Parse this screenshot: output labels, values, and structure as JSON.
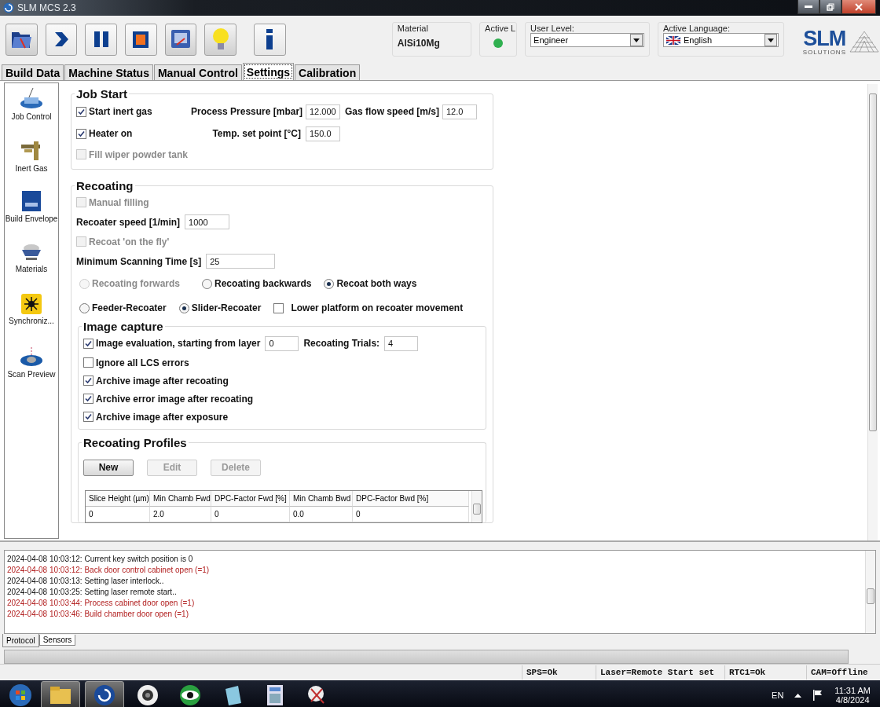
{
  "window": {
    "title": "SLM MCS 2.3"
  },
  "header": {
    "material": {
      "label": "Material",
      "value": "AlSi10Mg"
    },
    "active_laser": {
      "label": "Active L",
      "on": true
    },
    "user_level": {
      "label": "User Level:",
      "value": "Engineer"
    },
    "language": {
      "label": "Active Language:",
      "value": "English"
    },
    "logo": {
      "name": "SLM",
      "tagline": "SOLUTIONS"
    }
  },
  "tabs": [
    {
      "label": "Build Data",
      "selected": false
    },
    {
      "label": "Machine Status",
      "selected": false
    },
    {
      "label": "Manual Control",
      "selected": false
    },
    {
      "label": "Settings",
      "selected": true
    },
    {
      "label": "Calibration",
      "selected": false
    }
  ],
  "sidebar": {
    "items": [
      {
        "label": "Job Control",
        "kind": "job"
      },
      {
        "label": "Inert Gas",
        "kind": "gas"
      },
      {
        "label": "Build Envelope",
        "kind": "envelope"
      },
      {
        "label": "Materials",
        "kind": "materials"
      },
      {
        "label": "Synchroniz...",
        "kind": "sync"
      },
      {
        "label": "Scan Preview",
        "kind": "scan"
      }
    ]
  },
  "job_start": {
    "title": "Job Start",
    "start_inert_gas": {
      "label": "Start inert gas",
      "checked": true,
      "disabled": false
    },
    "process_pressure": {
      "label": "Process Pressure [mbar]",
      "value": "12.000"
    },
    "gas_flow_speed": {
      "label": "Gas flow speed [m/s]",
      "value": "12.0"
    },
    "heater_on": {
      "label": "Heater on",
      "checked": true,
      "disabled": false
    },
    "temp_set_point": {
      "label": "Temp. set point [°C]",
      "value": "150.0"
    },
    "fill_wiper": {
      "label": "Fill wiper powder tank",
      "checked": false,
      "disabled": true
    }
  },
  "recoating": {
    "title": "Recoating",
    "manual_filling": {
      "label": "Manual filling",
      "checked": false,
      "disabled": true
    },
    "recoater_speed": {
      "label": "Recoater speed [1/min]",
      "value": "1000"
    },
    "recoat_on_fly": {
      "label": "Recoat 'on the fly'",
      "checked": false,
      "disabled": true
    },
    "min_scan_time": {
      "label": "Minimum Scanning Time [s]",
      "value": "25"
    },
    "direction": [
      {
        "label": "Recoating forwards",
        "selected": false,
        "disabled": true
      },
      {
        "label": "Recoating backwards",
        "selected": false,
        "disabled": false
      },
      {
        "label": "Recoat both ways",
        "selected": true,
        "disabled": false
      }
    ],
    "recoater_type": [
      {
        "label": "Feeder-Recoater",
        "selected": false,
        "disabled": false
      },
      {
        "label": "Slider-Recoater",
        "selected": true,
        "disabled": false
      }
    ],
    "lower_platform": {
      "label": "Lower platform on recoater movement",
      "checked": false,
      "disabled": false
    }
  },
  "image_capture": {
    "title": "Image capture",
    "evaluation": {
      "label": "Image evaluation, starting from layer",
      "checked": true,
      "disabled": false
    },
    "start_layer": {
      "value": "0"
    },
    "trials": {
      "label": "Recoating Trials:",
      "value": "4"
    },
    "options": [
      {
        "label": "Ignore all LCS errors",
        "checked": false,
        "disabled": false
      },
      {
        "label": "Archive image after recoating",
        "checked": true,
        "disabled": false
      },
      {
        "label": "Archive error image after recoating",
        "checked": true,
        "disabled": false
      },
      {
        "label": "Archive image after exposure",
        "checked": true,
        "disabled": false
      }
    ]
  },
  "profiles": {
    "title": "Recoating Profiles",
    "buttons": [
      {
        "label": "New",
        "disabled": false
      },
      {
        "label": "Edit",
        "disabled": true
      },
      {
        "label": "Delete",
        "disabled": true
      }
    ],
    "columns": [
      "Slice Height (µm)",
      "Min Chamb Fwd",
      "DPC-Factor Fwd [%]",
      "Min Chamb Bwd",
      "DPC-Factor Bwd [%]"
    ],
    "rows": [
      [
        "0",
        "2.0",
        "0",
        "0.0",
        "0"
      ]
    ]
  },
  "log": [
    {
      "text": "2024-04-08 10:03:12: Current key switch position is 0",
      "kind": "info"
    },
    {
      "text": "2024-04-08 10:03:12: Back door control cabinet open (=1)",
      "kind": "error"
    },
    {
      "text": "2024-04-08 10:03:13: Setting laser interlock..",
      "kind": "info"
    },
    {
      "text": "2024-04-08 10:03:25: Setting laser remote start..",
      "kind": "info"
    },
    {
      "text": "2024-04-08 10:03:44: Process cabinet door open (=1)",
      "kind": "error"
    },
    {
      "text": "2024-04-08 10:03:46: Build chamber door open (=1)",
      "kind": "error"
    }
  ],
  "bottom_tabs": [
    {
      "label": "Protocol",
      "selected": true
    },
    {
      "label": "Sensors",
      "selected": false
    }
  ],
  "status_bar": [
    "SPS=Ok",
    "Laser=Remote Start set",
    "RTC1=Ok",
    "CAM=Offline"
  ],
  "taskbar": {
    "language": "EN",
    "time": "11:31 AM",
    "date": "4/8/2024"
  }
}
